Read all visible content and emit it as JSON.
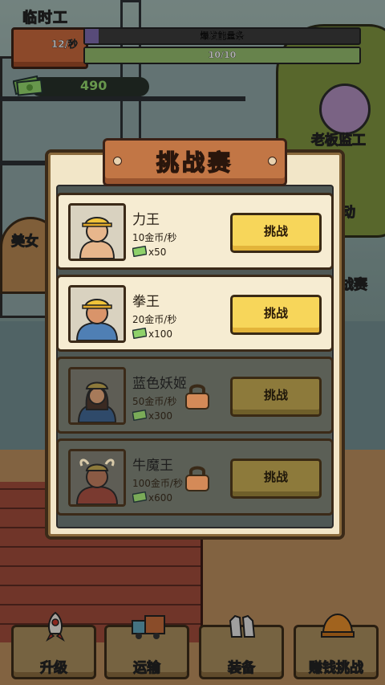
{
  "hud": {
    "worker_title": "临时工",
    "rate": "12/秒",
    "energy_bar_label": "爆发能量条",
    "energy_level": 0.05,
    "stamina_label": "10/10",
    "stamina_level": 1.0,
    "money": "490"
  },
  "side_buttons": {
    "boss": "老板监工",
    "beauty": "美女",
    "activity": "动",
    "competition": "战赛"
  },
  "modal": {
    "title": "挑战赛",
    "challengers": [
      {
        "name": "力王",
        "rate": "10金币/秒",
        "cost": "x50",
        "button": "挑战",
        "locked": false
      },
      {
        "name": "拳王",
        "rate": "20金币/秒",
        "cost": "x100",
        "button": "挑战",
        "locked": false
      },
      {
        "name": "蓝色妖姬",
        "rate": "50金币/秒",
        "cost": "x300",
        "button": "挑战",
        "locked": true
      },
      {
        "name": "牛魔王",
        "rate": "100金币/秒",
        "cost": "x600",
        "button": "挑战",
        "locked": true
      }
    ]
  },
  "bottom_nav": {
    "upgrade": "升级",
    "transport": "运输",
    "equip": "装备",
    "earn": "赚钱挑战"
  }
}
